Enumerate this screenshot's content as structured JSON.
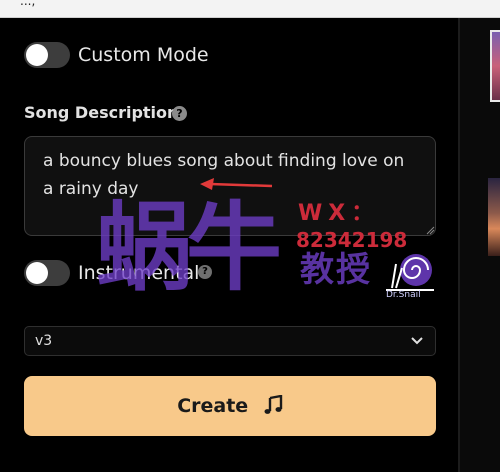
{
  "top_strip_text": "...,",
  "custom_mode": {
    "label": "Custom Mode",
    "enabled": false
  },
  "song_description": {
    "label": "Song Description",
    "value": "a bouncy blues song about finding love on a rainy day"
  },
  "instrumental": {
    "label": "Instrumental",
    "enabled": false
  },
  "version_select": {
    "value": "v3"
  },
  "create_button": {
    "label": "Create"
  },
  "icons": {
    "help": "help-circle-icon",
    "note": "music-note-icon",
    "chevron": "chevron-down-icon"
  },
  "colors": {
    "background": "#000000",
    "create_button": "#f8c98a",
    "toggle_off": "#3d3d3d",
    "annotation_arrow": "#e23a3a",
    "watermark_purple": "#6e3ec8",
    "watermark_red": "#cc2b3a"
  },
  "watermark": {
    "big_text": "蜗牛",
    "contact_label": "WX：",
    "contact_number": "82342198",
    "sub_text": "教授",
    "brand_small": "Dr.Snail"
  }
}
